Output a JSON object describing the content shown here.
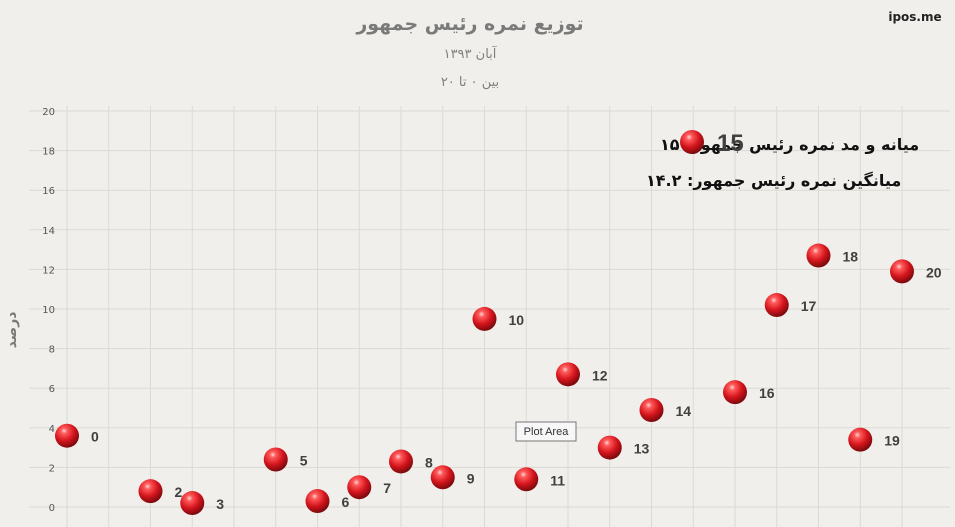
{
  "watermark": "ipos.me",
  "tooltip": "Plot Area",
  "chart_data": {
    "type": "scatter",
    "title": "توزیع نمره رئیس جمهور",
    "subtitle": "آبان ۱۳۹۳",
    "subtitle2": "بین ۰ تا ۲۰",
    "xlabel": "",
    "ylabel": "درصد",
    "ylim": [
      0,
      20
    ],
    "xlim": [
      0,
      20
    ],
    "yticks": [
      "0",
      "2",
      "4",
      "6",
      "8",
      "10",
      "12",
      "14",
      "16",
      "18",
      "20"
    ],
    "grid": true,
    "marker_color": "#e0212b",
    "points": [
      {
        "x": 0,
        "y": 3.6,
        "label": "0"
      },
      {
        "x": 2,
        "y": 0.8,
        "label": "2"
      },
      {
        "x": 3,
        "y": 0.2,
        "label": "3"
      },
      {
        "x": 5,
        "y": 2.4,
        "label": "5"
      },
      {
        "x": 6,
        "y": 0.3,
        "label": "6"
      },
      {
        "x": 7,
        "y": 1.0,
        "label": "7"
      },
      {
        "x": 8,
        "y": 2.3,
        "label": "8"
      },
      {
        "x": 9,
        "y": 1.5,
        "label": "9"
      },
      {
        "x": 10,
        "y": 9.5,
        "label": "10"
      },
      {
        "x": 11,
        "y": 1.4,
        "label": "11"
      },
      {
        "x": 12,
        "y": 6.7,
        "label": "12"
      },
      {
        "x": 13,
        "y": 3.0,
        "label": "13"
      },
      {
        "x": 14,
        "y": 4.9,
        "label": "14"
      },
      {
        "x": 16,
        "y": 5.8,
        "label": "16"
      },
      {
        "x": 17,
        "y": 10.2,
        "label": "17"
      },
      {
        "x": 18,
        "y": 12.7,
        "label": "18"
      },
      {
        "x": 19,
        "y": 3.4,
        "label": "19"
      },
      {
        "x": 20,
        "y": 11.9,
        "label": "20"
      }
    ],
    "annotations": {
      "legend_value": "15",
      "median_mode": "میانه و مد نمره رئیس جمهور: ۱۵",
      "mean": "میانگین نمره رئیس جمهور: ۱۴.۲"
    }
  }
}
